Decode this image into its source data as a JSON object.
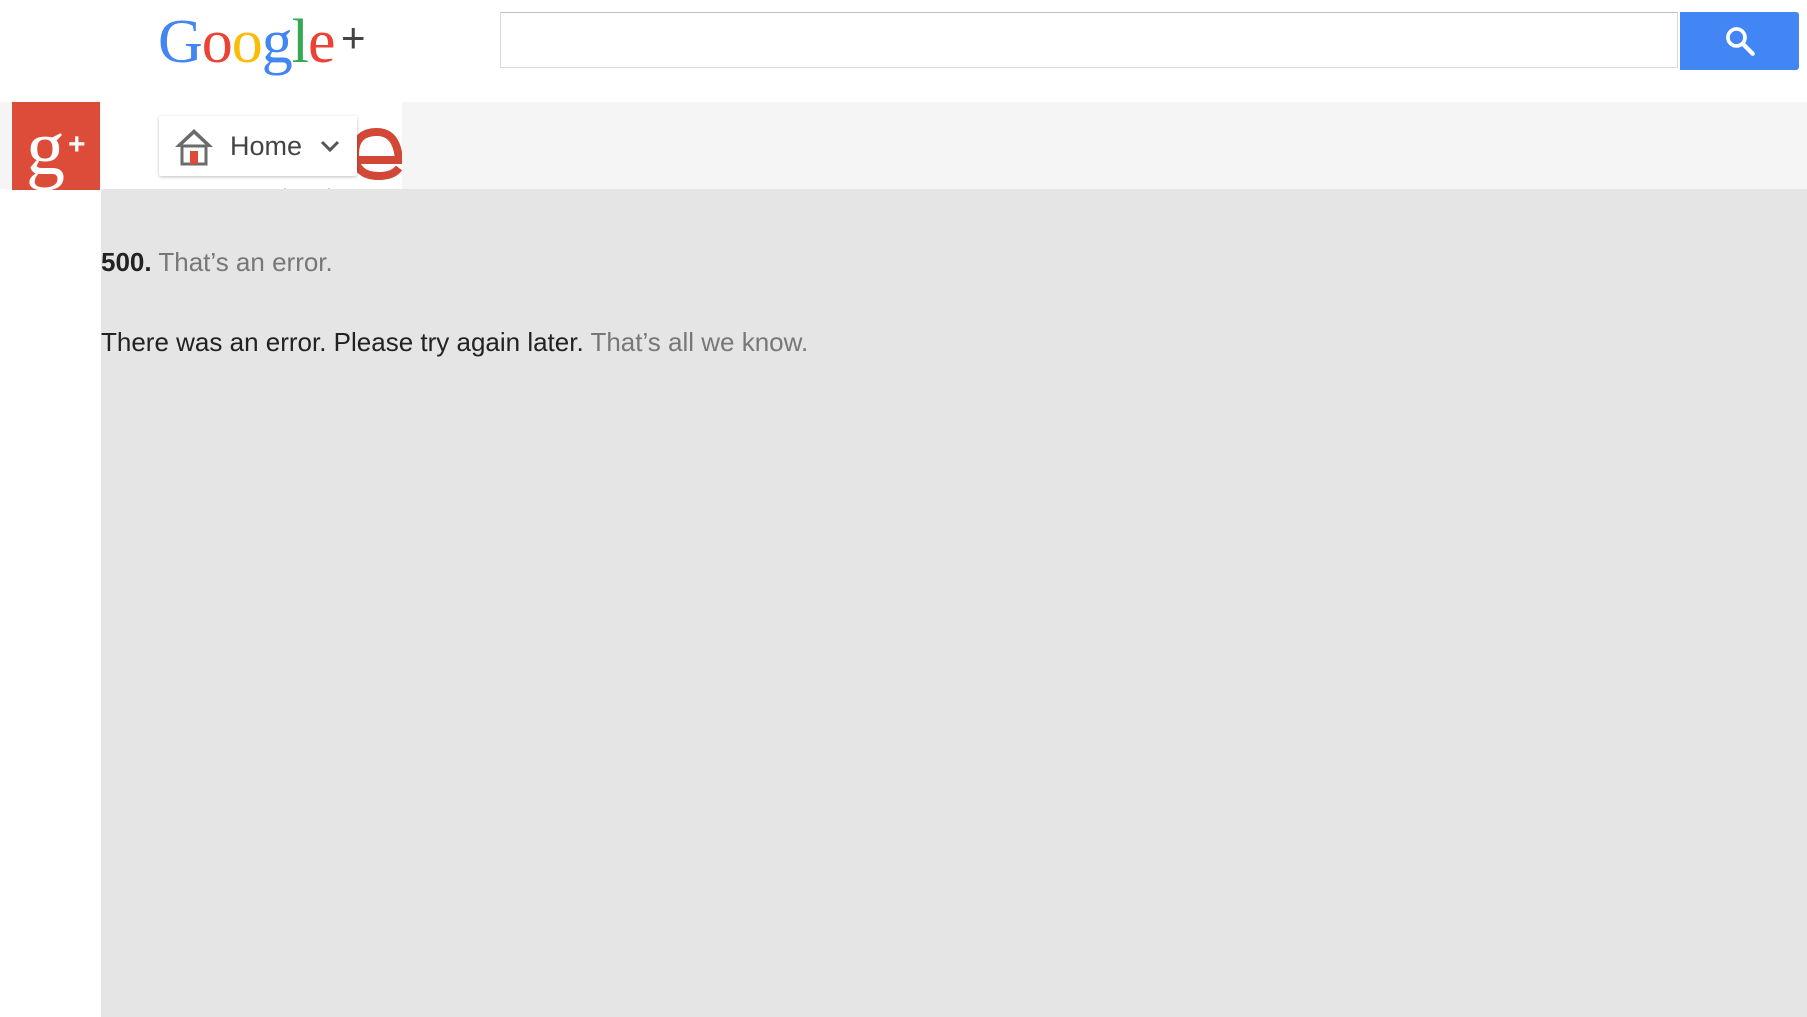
{
  "header": {
    "logo_letters": [
      {
        "char": "G",
        "color": "#4285f4"
      },
      {
        "char": "o",
        "color": "#ea4335"
      },
      {
        "char": "o",
        "color": "#fbbc05"
      },
      {
        "char": "g",
        "color": "#4285f4"
      },
      {
        "char": "l",
        "color": "#34a853"
      },
      {
        "char": "e",
        "color": "#ea4335"
      }
    ],
    "logo_plus": "+",
    "search": {
      "value": "",
      "placeholder": ""
    },
    "search_button_color": "#4285f4"
  },
  "nav": {
    "badge_color": "#dd4b39",
    "home_label": "Home",
    "home_icon": "house-icon",
    "dropdown_icon": "chevron-down-icon"
  },
  "error": {
    "code": "500.",
    "title": "That’s an error.",
    "message": "There was an error. Please try again later.",
    "footnote": "That’s all we know."
  },
  "colors": {
    "content_background": "#e5e5e5",
    "nav_background": "#f5f5f5",
    "muted_text": "#777777"
  }
}
